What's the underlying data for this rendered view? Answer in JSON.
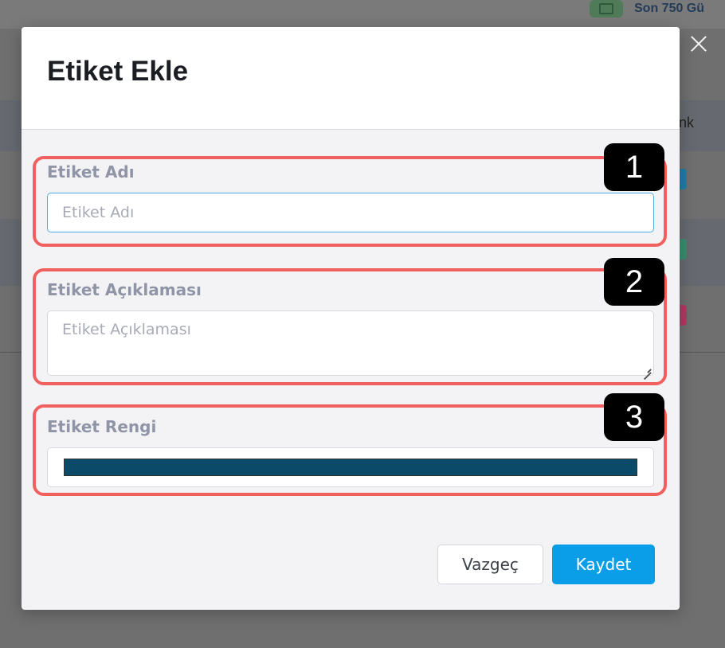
{
  "background": {
    "top_text": "Son 750 Gü",
    "header_partial": "nk"
  },
  "modal": {
    "title": "Etiket Ekle",
    "fields": {
      "name": {
        "label": "Etiket Adı",
        "placeholder": "Etiket Adı",
        "value": ""
      },
      "description": {
        "label": "Etiket Açıklaması",
        "placeholder": "Etiket Açıklaması",
        "value": ""
      },
      "color": {
        "label": "Etiket Rengi",
        "value": "#0b4a68"
      }
    },
    "buttons": {
      "cancel": "Vazgeç",
      "save": "Kaydet"
    }
  },
  "annotations": {
    "badge_1": "1",
    "badge_2": "2",
    "badge_3": "3"
  },
  "colors": {
    "overlay": "#6f6f6f",
    "primary": "#0a9ee8",
    "highlight": "#f0605f",
    "label": "#8f94a6"
  }
}
